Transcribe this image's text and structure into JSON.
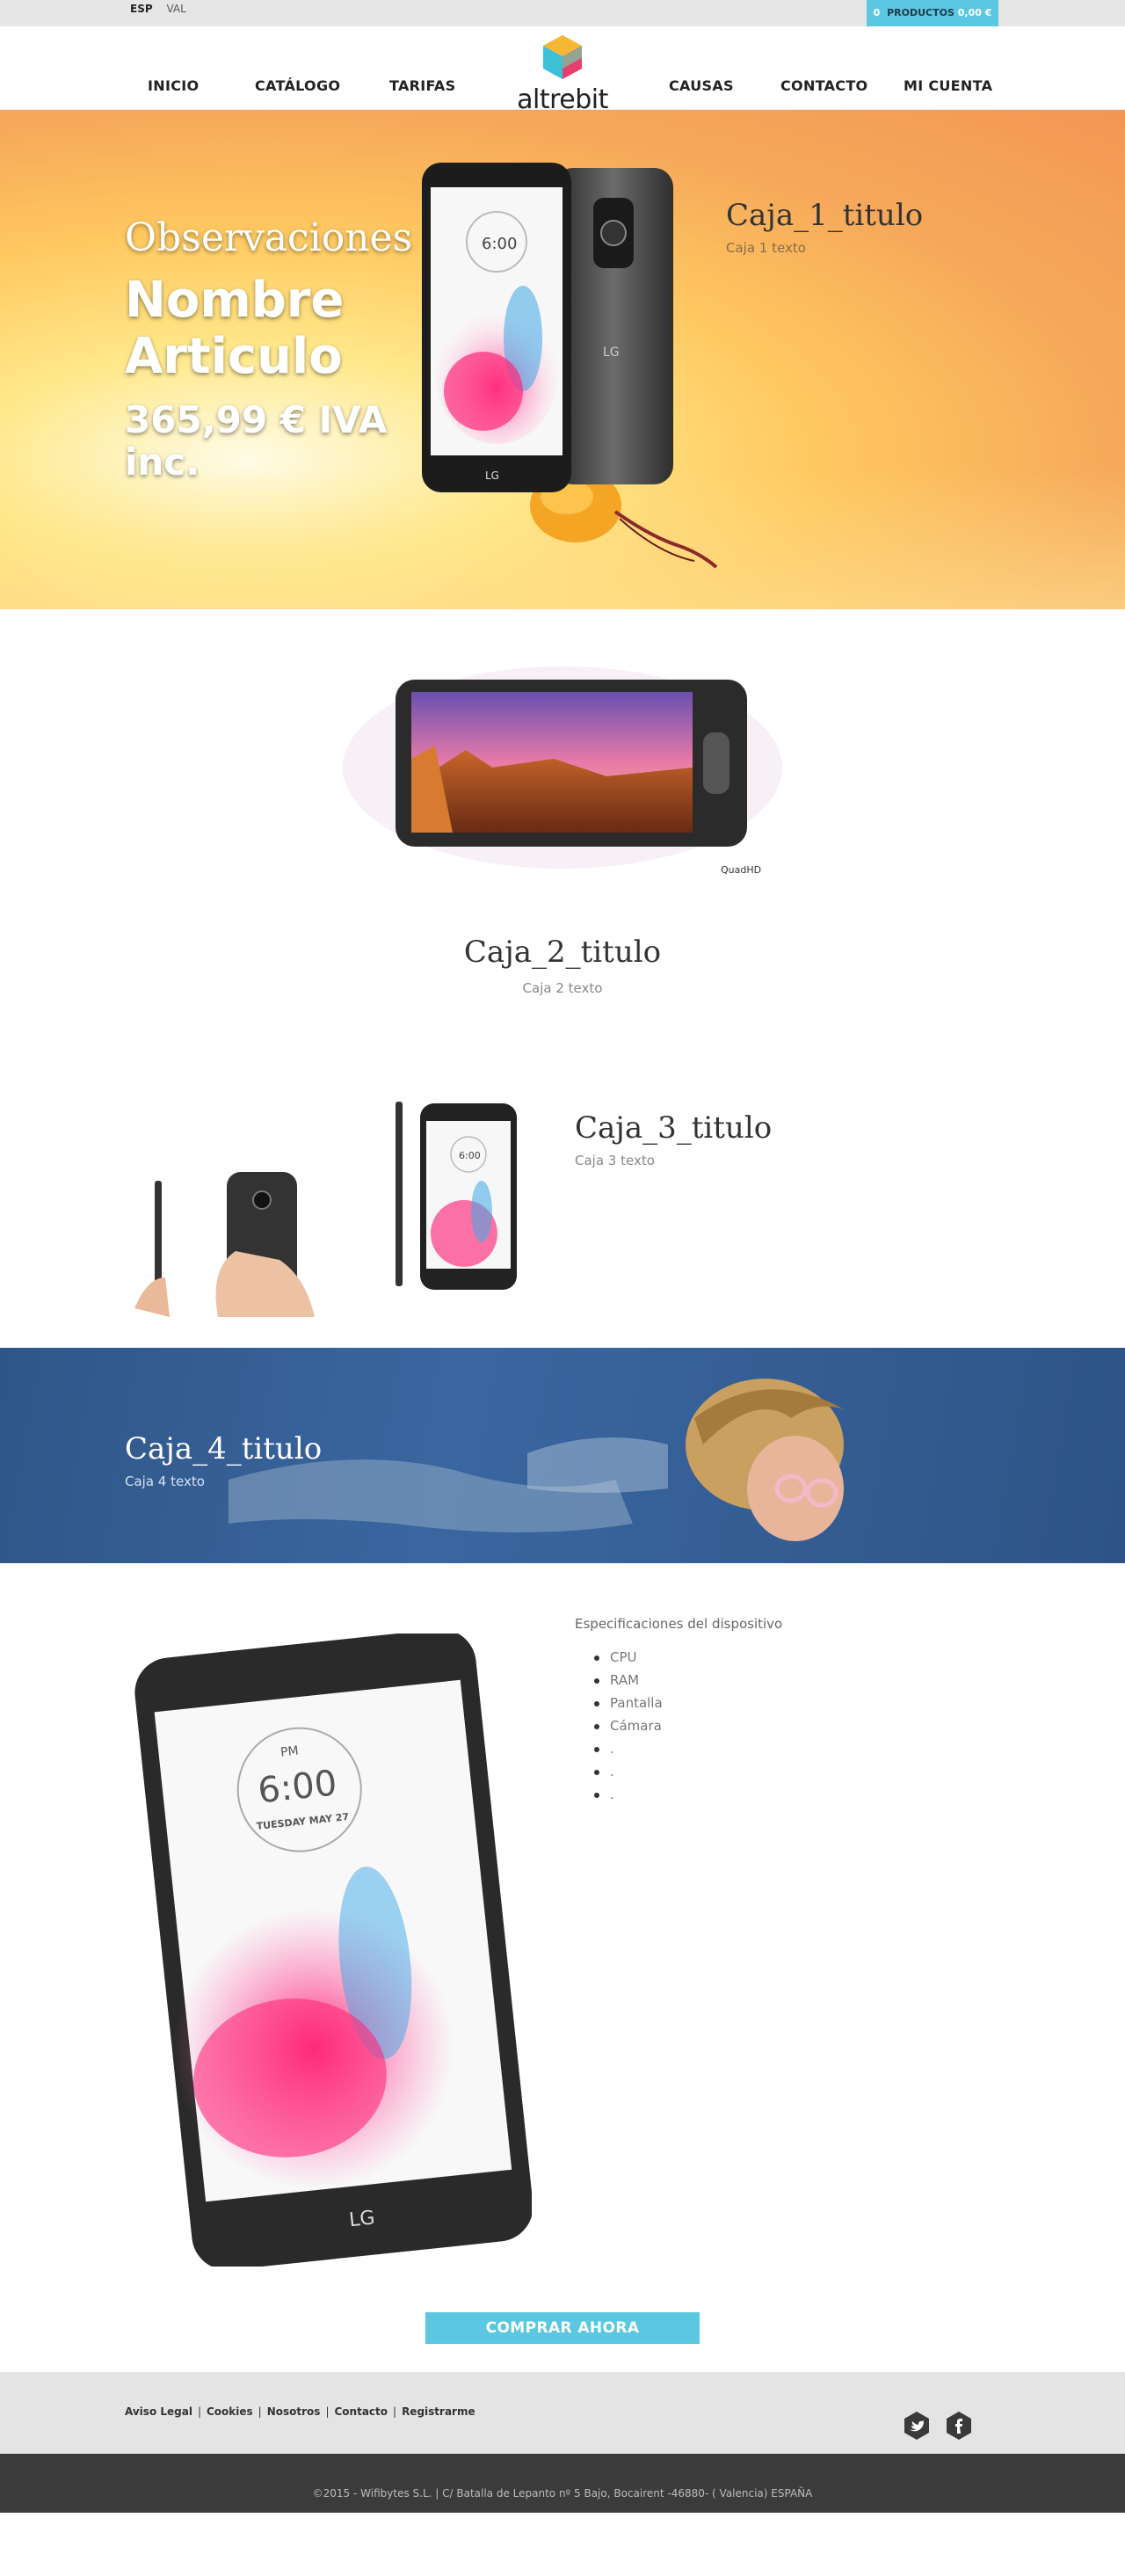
{
  "topbar": {
    "languages": [
      "ESP",
      "VAL"
    ],
    "cart": {
      "count": "0",
      "label": "PRODUCTOS",
      "total": "0,00 €"
    }
  },
  "nav": {
    "items_left": [
      "INICIO",
      "CATÁLOGO",
      "TARIFAS"
    ],
    "items_right": [
      "CAUSAS",
      "CONTACTO",
      "MI CUENTA"
    ],
    "logo_text": "altrebit"
  },
  "hero": {
    "observaciones": "Observaciones",
    "name": "Nombre Articulo",
    "price": "365,99 € IVA inc.",
    "box1_title": "Caja_1_titulo",
    "box1_text": "Caja 1 texto",
    "phone_time": "6:00",
    "phone_brand": "LG"
  },
  "section2": {
    "title": "Caja_2_titulo",
    "text": "Caja 2 texto",
    "badge": "QuadHD"
  },
  "section3": {
    "title": "Caja_3_titulo",
    "text": "Caja 3 texto",
    "phone_time": "6:00"
  },
  "section4": {
    "title": "Caja_4_titulo",
    "text": "Caja 4 texto"
  },
  "section5": {
    "specs_title": "Especificaciones del dispositivo",
    "specs": [
      "CPU",
      "RAM",
      "Pantalla",
      "Cámara",
      ".",
      ".",
      "."
    ],
    "phone_ampm": "PM",
    "phone_time": "6:00",
    "phone_date": "TUESDAY MAY 27",
    "phone_brand": "LG",
    "buy_label": "COMPRAR AHORA"
  },
  "footer": {
    "links": [
      "Aviso Legal",
      "Cookies",
      "Nosotros",
      "Contacto",
      "Registrarme"
    ],
    "social": [
      "twitter-icon",
      "facebook-icon"
    ],
    "copyright": "©2015 - Wifibytes S.L. | C/ Batalla de Lepanto nº 5 Bajo, Bocairent -46880- ( Valencia) ESPAÑA"
  },
  "colors": {
    "accent": "#5bc7e0",
    "topbar": "#e6e6e6",
    "footer": "#e4e4e4",
    "bottombar": "#3b3b3b"
  }
}
